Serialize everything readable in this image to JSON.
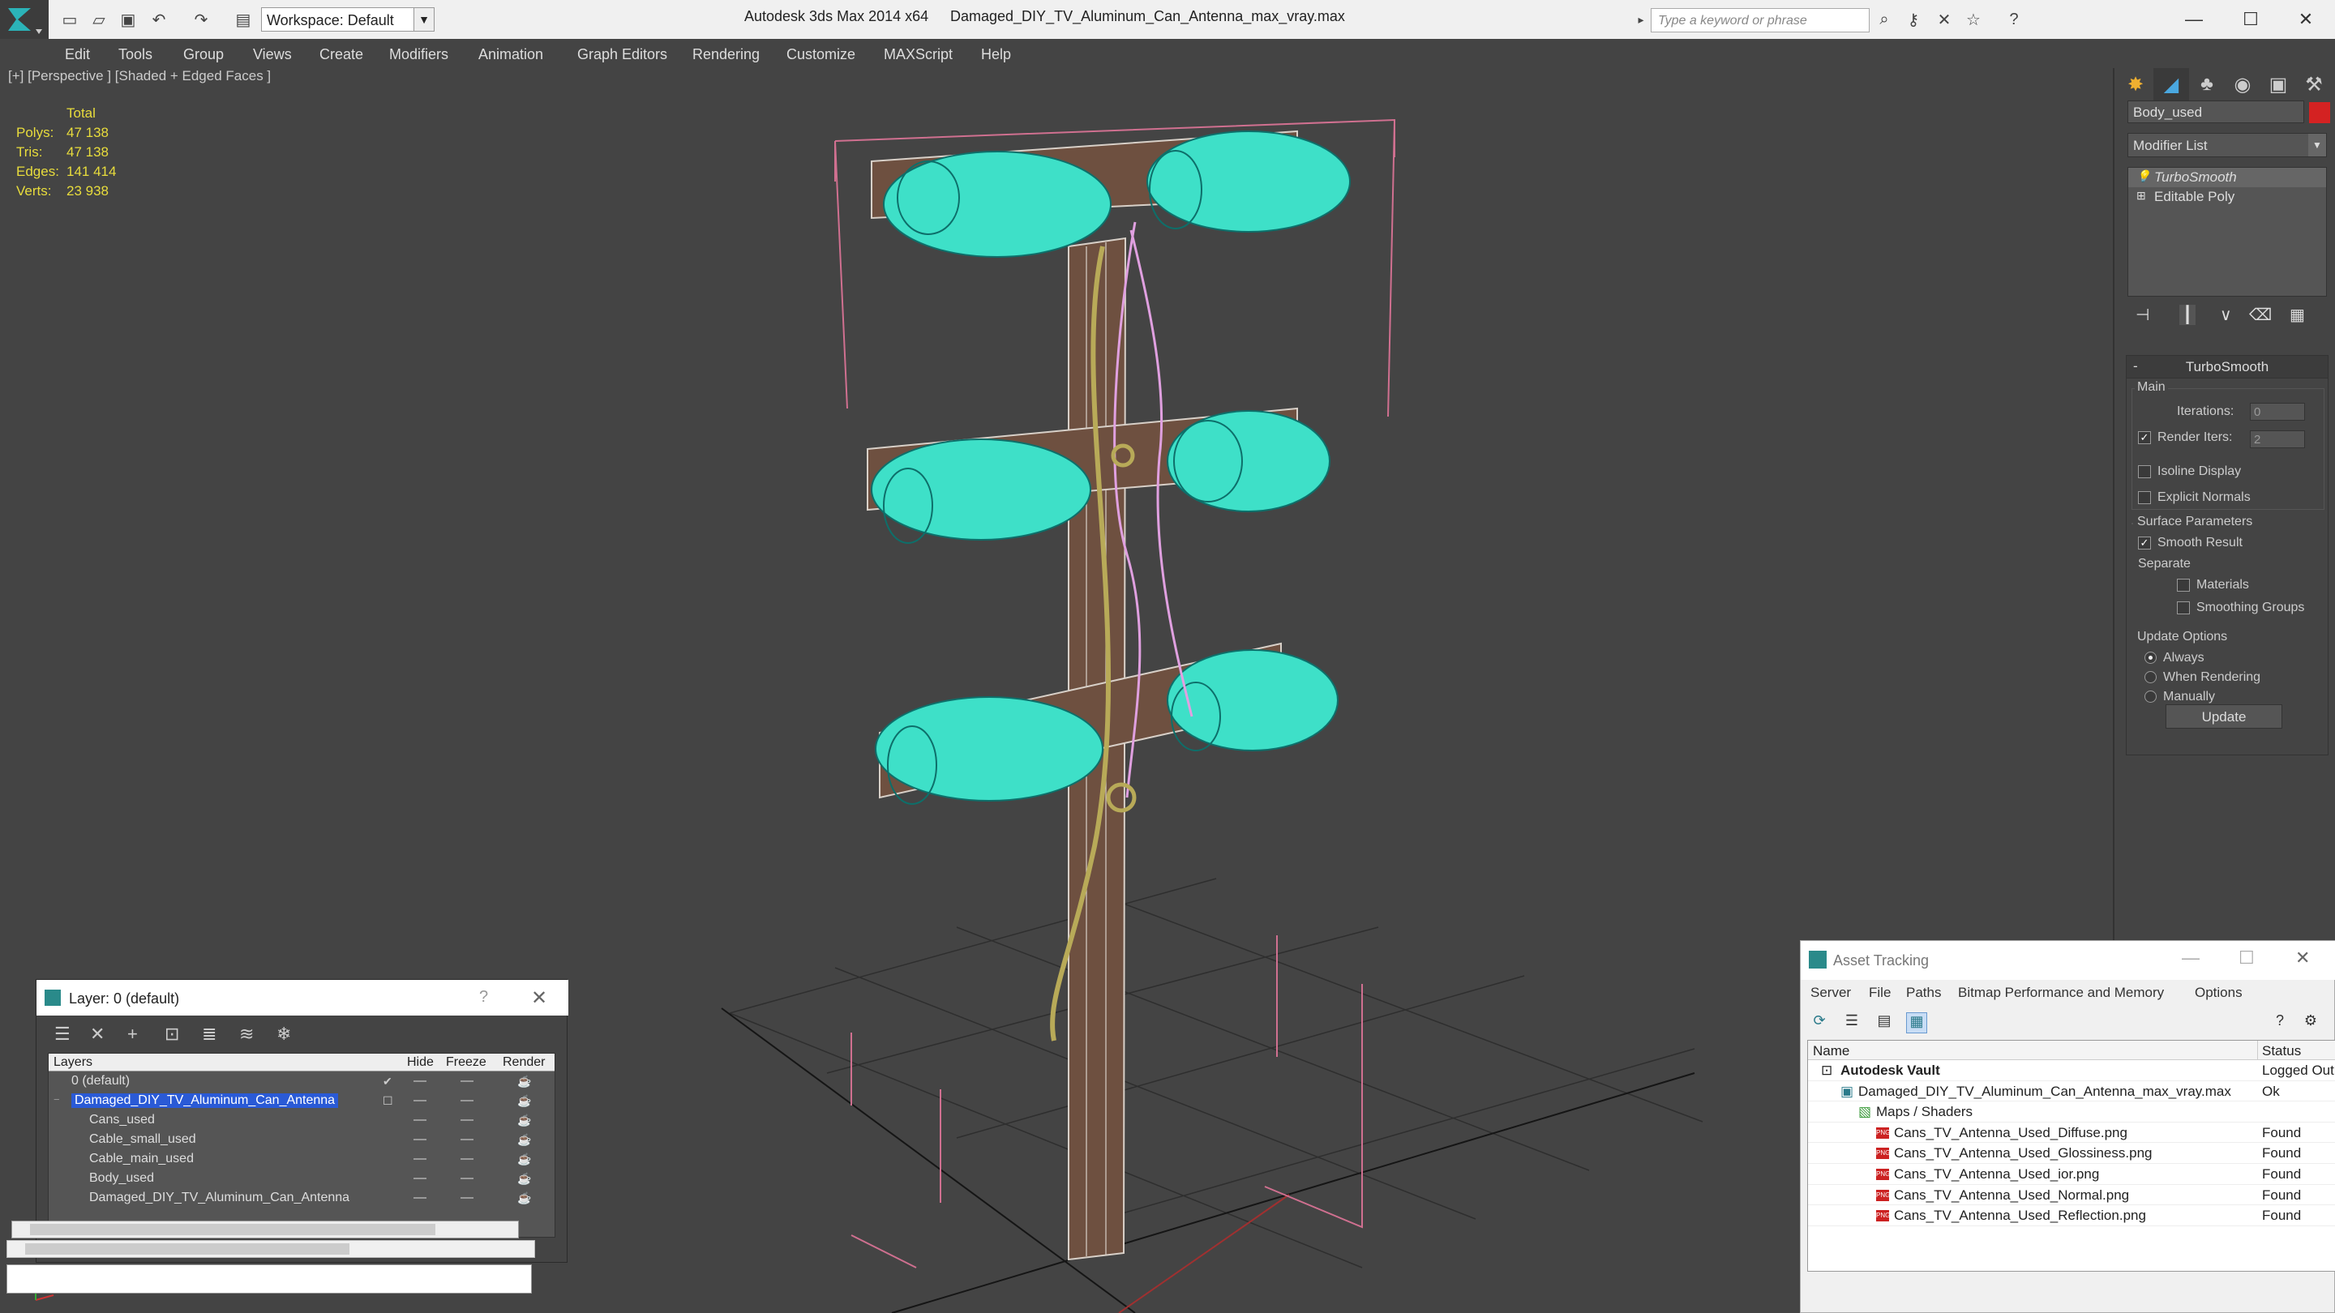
{
  "titlebar": {
    "workspace": "Workspace: Default",
    "app_title": "Autodesk 3ds Max  2014 x64",
    "filename": "Damaged_DIY_TV_Aluminum_Can_Antenna_max_vray.max",
    "search_placeholder": "Type a keyword or phrase"
  },
  "menu": [
    "Edit",
    "Tools",
    "Group",
    "Views",
    "Create",
    "Modifiers",
    "Animation",
    "Graph Editors",
    "Rendering",
    "Customize",
    "MAXScript",
    "Help"
  ],
  "viewport": {
    "label": "[+] [Perspective ] [Shaded + Edged Faces ]",
    "stats": {
      "header": "Total",
      "polys_label": "Polys:",
      "polys": "47 138",
      "tris_label": "Tris:",
      "tris": "47 138",
      "edges_label": "Edges:",
      "edges": "141 414",
      "verts_label": "Verts:",
      "verts": "23 938"
    }
  },
  "command_panel": {
    "object_name": "Body_used",
    "object_color": "#d42222",
    "modifier_list": "Modifier List",
    "stack": [
      "TurboSmooth",
      "Editable Poly"
    ],
    "rollout_title": "TurboSmooth",
    "main_label": "Main",
    "iterations_label": "Iterations:",
    "iterations": "0",
    "render_iters_label": "Render Iters:",
    "render_iters": "2",
    "isoline_display": "Isoline Display",
    "explicit_normals": "Explicit Normals",
    "surface_params": "Surface Parameters",
    "smooth_result": "Smooth Result",
    "separate": "Separate",
    "materials": "Materials",
    "smoothing_groups": "Smoothing Groups",
    "update_options": "Update Options",
    "always": "Always",
    "when_rendering": "When Rendering",
    "manually": "Manually",
    "update_button": "Update"
  },
  "layer_dialog": {
    "title": "Layer: 0 (default)",
    "columns": {
      "layers": "Layers",
      "hide": "Hide",
      "freeze": "Freeze",
      "render": "Render"
    },
    "rows": [
      {
        "name": "0 (default)"
      },
      {
        "name": "Damaged_DIY_TV_Aluminum_Can_Antenna"
      },
      {
        "name": "Cans_used"
      },
      {
        "name": "Cable_small_used"
      },
      {
        "name": "Cable_main_used"
      },
      {
        "name": "Body_used"
      },
      {
        "name": "Damaged_DIY_TV_Aluminum_Can_Antenna"
      }
    ]
  },
  "asset_tracking": {
    "title": "Asset Tracking",
    "menu": [
      "Server",
      "File",
      "Paths",
      "Bitmap Performance and Memory",
      "Options"
    ],
    "col_name": "Name",
    "col_status": "Status",
    "rows": [
      {
        "name": "Autodesk Vault",
        "status": "Logged Out"
      },
      {
        "name": "Damaged_DIY_TV_Aluminum_Can_Antenna_max_vray.max",
        "status": "Ok"
      },
      {
        "name": "Maps / Shaders",
        "status": ""
      },
      {
        "name": "Cans_TV_Antenna_Used_Diffuse.png",
        "status": "Found"
      },
      {
        "name": "Cans_TV_Antenna_Used_Glossiness.png",
        "status": "Found"
      },
      {
        "name": "Cans_TV_Antenna_Used_ior.png",
        "status": "Found"
      },
      {
        "name": "Cans_TV_Antenna_Used_Normal.png",
        "status": "Found"
      },
      {
        "name": "Cans_TV_Antenna_Used_Reflection.png",
        "status": "Found"
      }
    ]
  },
  "colors": {
    "wire_cyan": "#3ee0c8",
    "wood": "#6e5040",
    "bbox_pink": "#d07090",
    "cable_pink": "#e0a0e0",
    "cable_yellow": "#b8aa58",
    "selected": "#2a5ad6"
  }
}
